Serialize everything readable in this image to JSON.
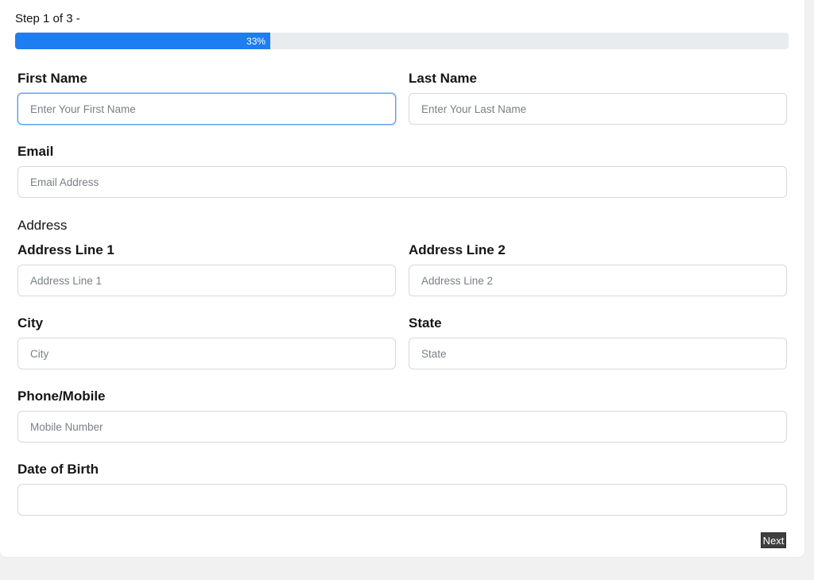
{
  "step": {
    "text": "Step 1 of 3 -",
    "progress_percent": 33,
    "progress_label": "33%"
  },
  "form": {
    "first_name": {
      "label": "First Name",
      "placeholder": "Enter Your First Name",
      "value": ""
    },
    "last_name": {
      "label": "Last Name",
      "placeholder": "Enter Your Last Name",
      "value": ""
    },
    "email": {
      "label": "Email",
      "placeholder": "Email Address",
      "value": ""
    },
    "address_section": "Address",
    "address_line1": {
      "label": "Address Line 1",
      "placeholder": "Address Line 1",
      "value": ""
    },
    "address_line2": {
      "label": "Address Line 2",
      "placeholder": "Address Line 2",
      "value": ""
    },
    "city": {
      "label": "City",
      "placeholder": "City",
      "value": ""
    },
    "state": {
      "label": "State",
      "placeholder": "State",
      "value": ""
    },
    "phone": {
      "label": "Phone/Mobile",
      "placeholder": "Mobile Number",
      "value": ""
    },
    "dob": {
      "label": "Date of Birth",
      "placeholder": "",
      "value": ""
    }
  },
  "buttons": {
    "next": "Next"
  },
  "colors": {
    "accent": "#1e7ef0",
    "progress_track": "#e9ecef",
    "button_bg": "#3f3f3f"
  }
}
